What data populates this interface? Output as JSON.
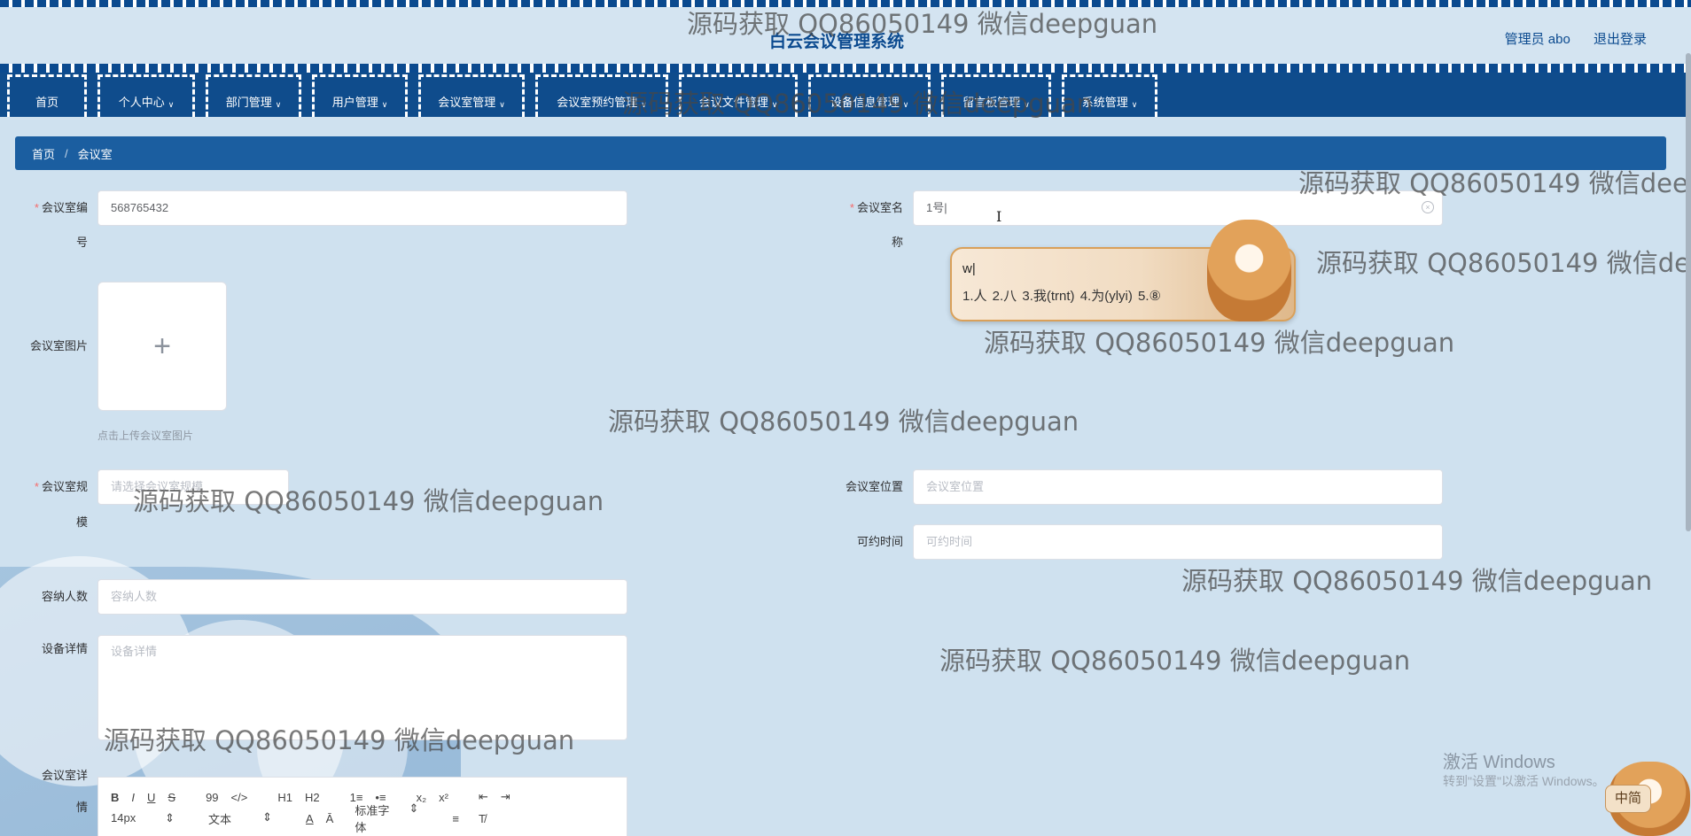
{
  "header": {
    "title": "白云会议管理系统",
    "user_label": "管理员 abo",
    "logout_label": "退出登录"
  },
  "nav": {
    "items": [
      {
        "label": "首页",
        "has_dropdown": false
      },
      {
        "label": "个人中心",
        "has_dropdown": true
      },
      {
        "label": "部门管理",
        "has_dropdown": true
      },
      {
        "label": "用户管理",
        "has_dropdown": true
      },
      {
        "label": "会议室管理",
        "has_dropdown": true
      },
      {
        "label": "会议室预约管理",
        "has_dropdown": true
      },
      {
        "label": "会议文件管理",
        "has_dropdown": true
      },
      {
        "label": "设备信息管理",
        "has_dropdown": true
      },
      {
        "label": "留言板管理",
        "has_dropdown": true
      },
      {
        "label": "系统管理",
        "has_dropdown": true
      }
    ]
  },
  "breadcrumb": {
    "home": "首页",
    "separator": "/",
    "current": "会议室"
  },
  "form": {
    "room_no": {
      "label_line1": "会议室编",
      "label_line2": "号",
      "value": "568765432",
      "required": true
    },
    "room_name": {
      "label_line1": "会议室名",
      "label_line2": "称",
      "value": "1号|",
      "required": true
    },
    "room_image": {
      "label": "会议室图片",
      "upload_glyph": "+",
      "hint": "点击上传会议室图片"
    },
    "room_scale": {
      "label_line1": "会议室规",
      "label_line2": "模",
      "placeholder": "请选择会议室规模",
      "required": true
    },
    "room_location": {
      "label": "会议室位置",
      "placeholder": "会议室位置"
    },
    "available_time": {
      "label": "可约时间",
      "placeholder": "可约时间"
    },
    "capacity": {
      "label": "容纳人数",
      "placeholder": "容纳人数"
    },
    "equipment": {
      "label": "设备详情",
      "placeholder": "设备详情"
    },
    "room_detail": {
      "label_line1": "会议室详",
      "label_line2": "情"
    }
  },
  "editor_toolbar": {
    "row1": [
      "B",
      "I",
      "U",
      "S",
      "99",
      "</>",
      "H1",
      "H2",
      "1≡",
      "•≡",
      "x₂",
      "x²",
      "⇤",
      "⇥"
    ],
    "font_size": "14px",
    "text_style": "文本",
    "font_family": "标准字体"
  },
  "ime": {
    "input": "w|",
    "candidates": "1.人  2.八  3.我(trnt)  4.为(ylyi)  5.⑧",
    "badge": "中简"
  },
  "watermark_text": "源码获取 QQ86050149 微信deepguan",
  "windows_activation": {
    "title": "激活 Windows",
    "subtitle": "转到\"设置\"以激活 Windows。"
  }
}
